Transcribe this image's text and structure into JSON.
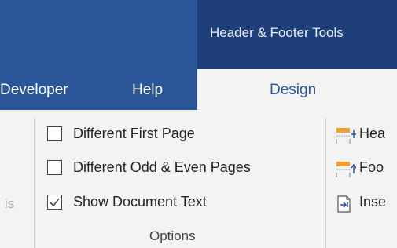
{
  "context": {
    "header_footer_tools": "Header & Footer Tools"
  },
  "tabs": {
    "developer": "Developer",
    "help": "Help",
    "design": "Design"
  },
  "ribbon": {
    "left_partial_text": "is",
    "options_group": {
      "label": "Options",
      "items": [
        {
          "label": "Different First Page",
          "checked": false
        },
        {
          "label": "Different Odd & Even Pages",
          "checked": false
        },
        {
          "label": "Show Document Text",
          "checked": true
        }
      ]
    },
    "position_group": {
      "items": [
        {
          "label": "Hea",
          "icon": "header-from-top-icon"
        },
        {
          "label": "Foo",
          "icon": "footer-from-bottom-icon"
        },
        {
          "label": "Inse",
          "icon": "insert-alignment-tab-icon"
        }
      ]
    }
  },
  "colors": {
    "ribbon_blue": "#2b579a",
    "contextual_blue": "#1e3f7a",
    "ribbon_background": "#f3f3f3",
    "icon_orange": "#f0a030"
  }
}
